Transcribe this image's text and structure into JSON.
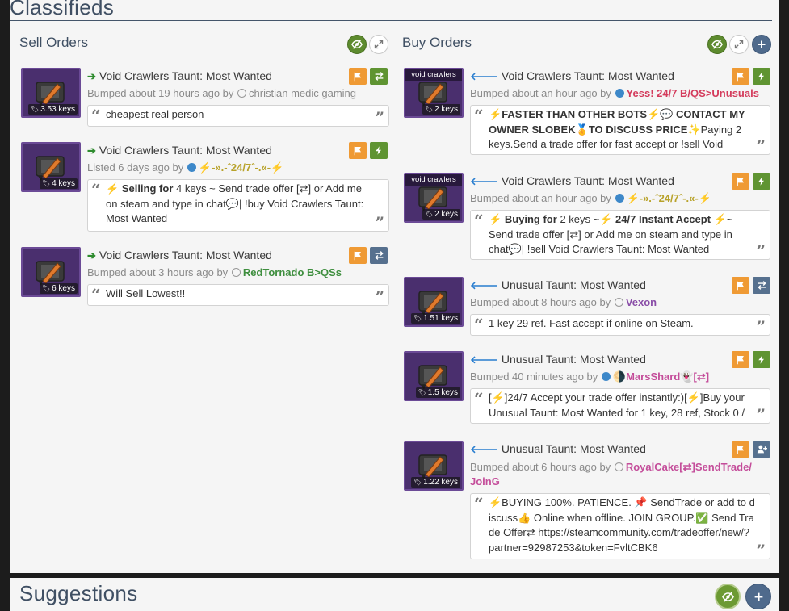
{
  "page": {
    "classifieds_heading": "Classifieds",
    "suggestions_heading": "Suggestions"
  },
  "colors": {
    "accent_green": "#5d8b2e",
    "accent_orange": "#ef9a34",
    "accent_slate": "#56708e",
    "item_purple": "#4a2f6e"
  },
  "sell": {
    "heading": "Sell Orders",
    "orders": [
      {
        "title": "Void Crawlers Taunt: Most Wanted",
        "price": "3.53 keys",
        "meta_prefix": "Bumped about 19 hours ago by",
        "user": "christian medic gaming",
        "message": "cheapest real person"
      },
      {
        "title": "Void Crawlers Taunt: Most Wanted",
        "price": "4 keys",
        "meta_prefix": "Listed 6 days ago by",
        "user": "-».-ˆ24/7ˆ-.«-",
        "message_bold": "Selling for",
        "message": "4 keys ~ Send trade offer [⇄] or Add me on steam and type in chat💬| !buy Void Crawlers Taunt: Most Wanted"
      },
      {
        "title": "Void Crawlers Taunt: Most Wanted",
        "price": "6 keys",
        "meta_prefix": "Bumped about 3 hours ago by",
        "user": "RedTornado B>QSs",
        "message": "Will Sell Lowest!!"
      }
    ]
  },
  "buy": {
    "heading": "Buy Orders",
    "orders": [
      {
        "strip": "void crawlers",
        "title": "Void Crawlers Taunt: Most Wanted",
        "price": "2 keys",
        "meta_prefix": "Bumped about an hour ago by",
        "user": "Yess! 24/7 B/QS>Unusuals",
        "message_bold": "FASTER THAN OTHER BOTS",
        "message_bold2": "CONTACT MY OWNER SLOBEK",
        "message_bold3": "TO DISCUSS PRICE",
        "message": "Paying 2 keys.Send a trade offer for fast accept or !sell Void Crawlers Taunt: Most Wanted"
      },
      {
        "strip": "void crawlers",
        "title": "Void Crawlers Taunt: Most Wanted",
        "price": "2 keys",
        "meta_prefix": "Bumped about an hour ago by",
        "user": "-».-ˆ24/7ˆ-.«-",
        "message_bold": "Buying for",
        "message_mid": "2 keys ~",
        "message_bold2": "24/7 Instant Accept",
        "message": "~ Send trade offer [⇄] or Add me on steam and type in chat💬| !sell Void Crawlers Taunt: Most Wanted"
      },
      {
        "title": "Unusual Taunt: Most Wanted",
        "price": "1.51 keys",
        "meta_prefix": "Bumped about 8 hours ago by",
        "user": "Vexon",
        "message": "1 key 29 ref. Fast accept if online on Steam."
      },
      {
        "title": "Unusual Taunt: Most Wanted",
        "price": "1.5 keys",
        "meta_prefix": "Bumped 40 minutes ago by",
        "user": "MarsShard",
        "user_suffix": "[⇄]",
        "message": "[⚡]24/7 Accept your trade offer instantly:)[⚡]Buy your Unusual Taunt: Most Wanted for 1 key, 28 ref, Stock 0 / 3."
      },
      {
        "title": "Unusual Taunt: Most Wanted",
        "price": "1.22 keys",
        "meta_prefix": "Bumped about 6 hours ago by",
        "user": "RoyalCake[⇄]SendTrade/ JoinG",
        "message": "⚡BUYING 100%. PATIENCE. 📌 SendTrade or add to discuss👍 Online when offline. JOIN GROUP.✅ Send Trade Offer⇄ https://steamcommunity.com/tradeoffer/new/?partner=92987253&token=FvltCBK6"
      }
    ]
  }
}
